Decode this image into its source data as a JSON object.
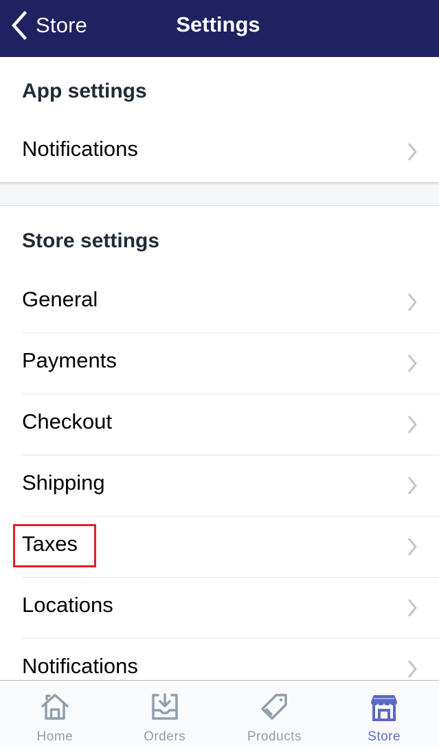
{
  "navbar": {
    "back_label": "Store",
    "title": "Settings",
    "background_color": "#1f2160"
  },
  "app_settings": {
    "title": "App settings",
    "items": [
      {
        "label": "Notifications",
        "icon": "chevron-right-icon"
      }
    ]
  },
  "store_settings": {
    "title": "Store settings",
    "items": [
      {
        "label": "General",
        "icon": "chevron-right-icon"
      },
      {
        "label": "Payments",
        "icon": "chevron-right-icon"
      },
      {
        "label": "Checkout",
        "icon": "chevron-right-icon"
      },
      {
        "label": "Shipping",
        "icon": "chevron-right-icon"
      },
      {
        "label": "Taxes",
        "icon": "chevron-right-icon",
        "highlighted": true
      },
      {
        "label": "Locations",
        "icon": "chevron-right-icon"
      },
      {
        "label": "Notifications",
        "icon": "chevron-right-icon"
      }
    ]
  },
  "highlight": {
    "target": "Taxes",
    "color": "#e0202b"
  },
  "tabbar": {
    "active_color": "#5c6ac4",
    "inactive_color": "#919eab",
    "tabs": [
      {
        "label": "Home",
        "icon": "home-icon",
        "active": false
      },
      {
        "label": "Orders",
        "icon": "orders-inbox-icon",
        "active": false
      },
      {
        "label": "Products",
        "icon": "tag-icon",
        "active": false
      },
      {
        "label": "Store",
        "icon": "storefront-icon",
        "active": true
      }
    ]
  }
}
